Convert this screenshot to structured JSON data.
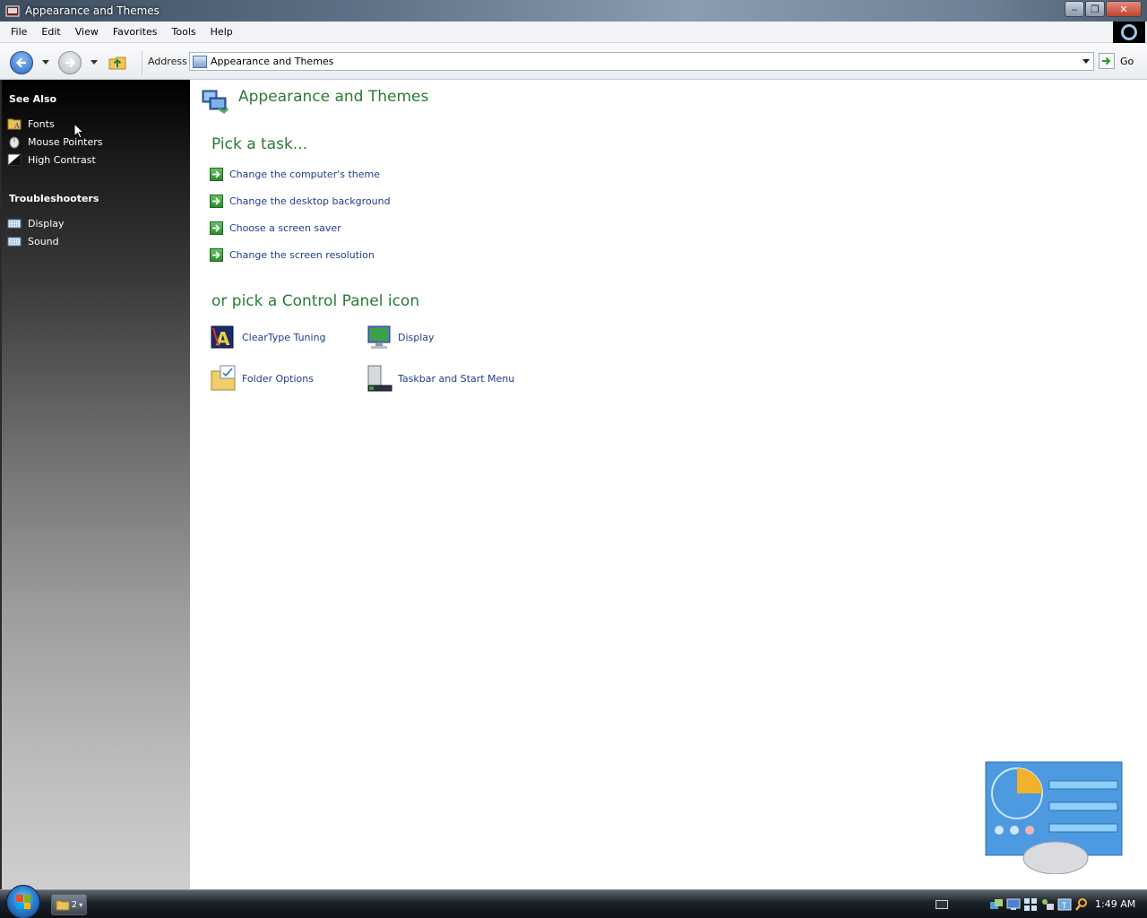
{
  "window": {
    "title": "Appearance and Themes",
    "buttons": {
      "minimize": "‒",
      "maximize": "❐",
      "close": "✕"
    }
  },
  "menubar": {
    "items": [
      {
        "label": "File"
      },
      {
        "label": "Edit"
      },
      {
        "label": "View"
      },
      {
        "label": "Favorites"
      },
      {
        "label": "Tools"
      },
      {
        "label": "Help"
      }
    ]
  },
  "toolbar": {
    "address_label": "Address",
    "address_value": "Appearance and Themes",
    "go_label": "Go"
  },
  "sidebar": {
    "see_also": {
      "title": "See Also",
      "items": [
        {
          "label": "Fonts",
          "icon": "fonts-folder-icon"
        },
        {
          "label": "Mouse Pointers",
          "icon": "mouse-icon"
        },
        {
          "label": "High Contrast",
          "icon": "high-contrast-icon"
        }
      ]
    },
    "troubleshooters": {
      "title": "Troubleshooters",
      "items": [
        {
          "label": "Display",
          "icon": "keyboard-icon"
        },
        {
          "label": "Sound",
          "icon": "keyboard-icon"
        }
      ]
    }
  },
  "main": {
    "page_title": "Appearance and Themes",
    "task_heading": "Pick a task...",
    "tasks": [
      {
        "label": "Change the computer's theme"
      },
      {
        "label": "Change the desktop background"
      },
      {
        "label": "Choose a screen saver"
      },
      {
        "label": "Change the screen resolution"
      }
    ],
    "icon_heading": "or pick a Control Panel icon",
    "icons": [
      {
        "label": "ClearType Tuning",
        "icon": "cleartype-icon"
      },
      {
        "label": "Display",
        "icon": "display-icon"
      },
      {
        "label": "Folder Options",
        "icon": "folder-options-icon"
      },
      {
        "label": "Taskbar and Start Menu",
        "icon": "taskbar-icon"
      }
    ]
  },
  "taskbar": {
    "task_button_count": "2",
    "clock": "1:49 AM"
  },
  "colors": {
    "heading_green": "#2b7a35",
    "link_blue": "#1f3d8a"
  }
}
